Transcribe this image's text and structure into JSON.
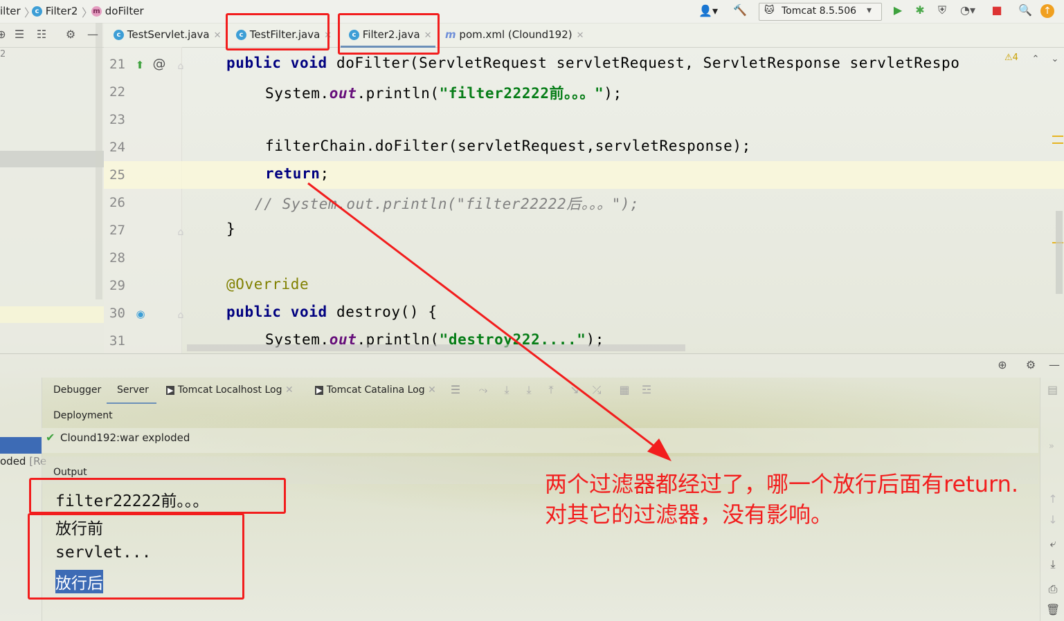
{
  "breadcrumb": {
    "items": [
      "ilter",
      "Filter2",
      "doFilter"
    ]
  },
  "toolbar": {
    "run_config": "Tomcat 8.5.506"
  },
  "editor_tabs": [
    {
      "label": "TestServlet.java",
      "badge": "c"
    },
    {
      "label": "TestFilter.java",
      "badge": "c"
    },
    {
      "label": "Filter2.java",
      "badge": "c"
    },
    {
      "label": "pom.xml (Clound192)",
      "badge": "m"
    }
  ],
  "left_panel": {
    "line_hint": "2",
    "exploded_text": "oded",
    "exploded_suffix": "[Re"
  },
  "editor": {
    "line_numbers": [
      "21",
      "22",
      "23",
      "24",
      "25",
      "26",
      "27",
      "28",
      "29",
      "30",
      "31"
    ],
    "warnings_count": "4",
    "lines": {
      "l21_kw1": "public",
      "l21_kw2": "void",
      "l21_rest": " doFilter(ServletRequest servletRequest, ServletResponse servletRespo",
      "l22_pre": "System.",
      "l22_field": "out",
      "l22_mid": ".println(",
      "l22_str": "\"filter22222前。。。\"",
      "l22_end": ");",
      "l24": "filterChain.doFilter(servletRequest,servletResponse);",
      "l25_kw": "return",
      "l25_end": ";",
      "l26": "// System.out.println(\"filter22222后。。。\");",
      "l27": "}",
      "l29": "@Override",
      "l30_kw1": "public",
      "l30_kw2": "void",
      "l30_rest": " destroy() {",
      "l31_pre": "System.",
      "l31_field": "out",
      "l31_mid": ".println(",
      "l31_str": "\"destroy222....\"",
      "l31_end": ");"
    }
  },
  "bottom_panel": {
    "tabs": [
      "Debugger",
      "Server",
      "Tomcat Localhost Log",
      "Tomcat Catalina Log"
    ],
    "deployment_label": "Deployment",
    "deployment_item": "Clound192:war exploded",
    "output_label": "Output",
    "output_lines": [
      "filter22222前。。。",
      "放行前",
      "servlet...",
      "放行后"
    ]
  },
  "annotation": {
    "line1": "两个过滤器都经过了，哪一个放行后面有return.",
    "line2": "对其它的过滤器，没有影响。"
  },
  "colors": {
    "keyword": "#000080",
    "string": "#067d17",
    "annotation_red": "#f21d1d",
    "selection": "#3d6bb5"
  }
}
